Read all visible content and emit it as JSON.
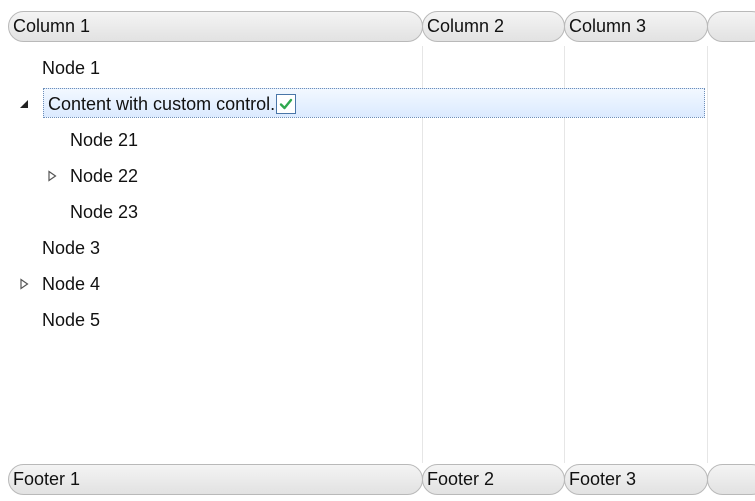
{
  "header": {
    "columns": [
      "Column 1",
      "Column 2",
      "Column 3",
      ""
    ]
  },
  "footer": {
    "cells": [
      "Footer 1",
      "Footer 2",
      "Footer 3",
      ""
    ]
  },
  "rows": [
    {
      "label": "Node 1",
      "level": 0,
      "expander": "none"
    },
    {
      "label": "Content with custom control.",
      "level": 0,
      "expander": "expanded",
      "selected": true,
      "custom_control": {
        "type": "checkbox",
        "checked": true
      }
    },
    {
      "label": "Node 21",
      "level": 1,
      "expander": "none"
    },
    {
      "label": "Node 22",
      "level": 1,
      "expander": "collapsed"
    },
    {
      "label": "Node 23",
      "level": 1,
      "expander": "none"
    },
    {
      "label": "Node 3",
      "level": 0,
      "expander": "none"
    },
    {
      "label": "Node 4",
      "level": 0,
      "expander": "collapsed"
    },
    {
      "label": "Node 5",
      "level": 0,
      "expander": "none"
    }
  ],
  "colors": {
    "selection_border": "#6f8fb8",
    "checkbox_check": "#2fa84f",
    "expander_collapsed": "#555555",
    "expander_expanded": "#222222"
  }
}
